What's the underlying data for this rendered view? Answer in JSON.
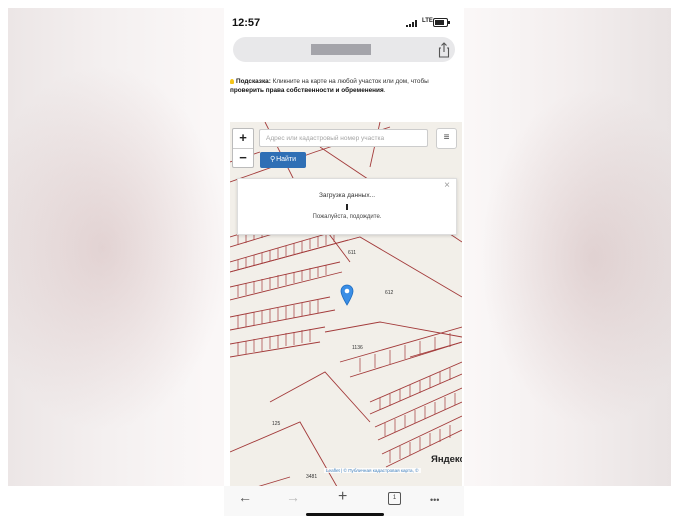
{
  "status_bar": {
    "time": "12:57",
    "network": "LTE"
  },
  "browser": {
    "url": "",
    "share_icon": "share-icon"
  },
  "hint": {
    "label": "Подсказка:",
    "text": " Кликните на карте на любой участок или дом, чтобы ",
    "link": "проверить права собственности и обременения",
    "end": "."
  },
  "map": {
    "zoom_in": "+",
    "zoom_out": "−",
    "search_placeholder": "Адрес или кадастровый номер участка",
    "menu_icon": "≡",
    "find_button": "Найти",
    "loading_title": "Загрузка данных...",
    "loading_wait": "Пожалуйста, подождите.",
    "close": "×",
    "parcel_labels": [
      "611",
      "612",
      "1136",
      "125",
      "3481"
    ],
    "yandex_logo": "Яндекс",
    "attribution": "Leaflet | © Публичная кадастровая карта, ©"
  },
  "toolbar": {
    "back": "←",
    "forward": "→",
    "new_tab": "+",
    "tabs_count": "1",
    "more": "•••"
  },
  "colors": {
    "accent": "#2f6fb5",
    "parcel_lines": "#a33b3b",
    "map_background": "#f2efe9"
  }
}
